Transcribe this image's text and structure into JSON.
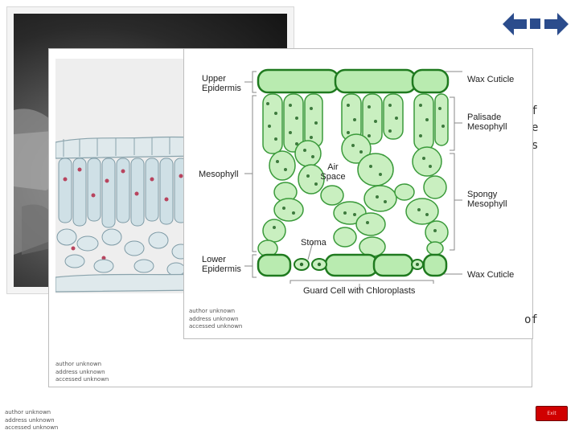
{
  "slide": {
    "credits": {
      "diagram": [
        "author unknown",
        "address unknown",
        "accessed unknown"
      ],
      "micrograph": [
        "author unknown",
        "address unknown",
        "accessed unknown"
      ],
      "sem": [
        "author unknown",
        "address unknown",
        "accessed unknown"
      ]
    },
    "partial_text": {
      "line1": "of",
      "line2": "e",
      "line3": "s",
      "line4": "of"
    }
  },
  "diagram": {
    "labels": {
      "upper_epidermis": [
        "Upper",
        "Epidermis"
      ],
      "mesophyll": "Mesophyll",
      "lower_epidermis": [
        "Lower",
        "Epidermis"
      ],
      "wax_cuticle_top": "Wax Cuticle",
      "palisade": [
        "Palisade",
        "Mesophyll"
      ],
      "spongy": [
        "Spongy",
        "Mesophyll"
      ],
      "wax_cuticle_bottom": "Wax Cuticle",
      "air_space": [
        "Air",
        "Space"
      ],
      "stoma": "Stoma",
      "guard_cell": "Guard Cell with Chloroplasts"
    }
  },
  "navigation": {
    "exit_label": "Exit"
  },
  "colors": {
    "nav_blue": "#2b4c8c",
    "exit_red": "#d00000",
    "cell_dark_green": "#2e8b2e",
    "cell_light_green": "#c9efc0"
  }
}
